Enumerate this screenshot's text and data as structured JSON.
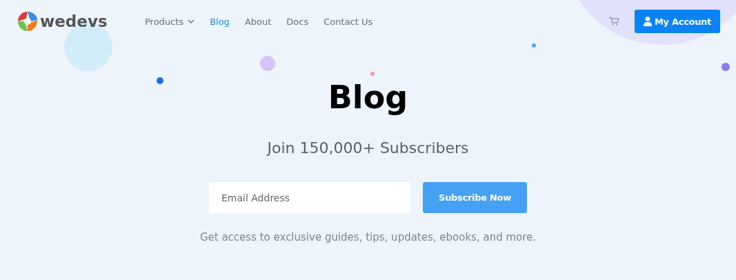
{
  "header": {
    "logo": "wedevs",
    "nav": [
      {
        "label": "Products",
        "selected": false,
        "has_dropdown": true
      },
      {
        "label": "Blog",
        "selected": true,
        "has_dropdown": false
      },
      {
        "label": "About",
        "selected": false,
        "has_dropdown": false
      },
      {
        "label": "Docs",
        "selected": false,
        "has_dropdown": false
      },
      {
        "label": "Contact Us",
        "selected": false,
        "has_dropdown": false
      }
    ],
    "account_button": "My Account"
  },
  "hero": {
    "title": "Blog",
    "subtitle": "Join 150,000+ Subscribers",
    "email": {
      "placeholder": "Email Address"
    },
    "subscribe_button": "Subscribe Now",
    "note": "Get access to exclusive guides, tips, updates, ebooks, and more."
  }
}
